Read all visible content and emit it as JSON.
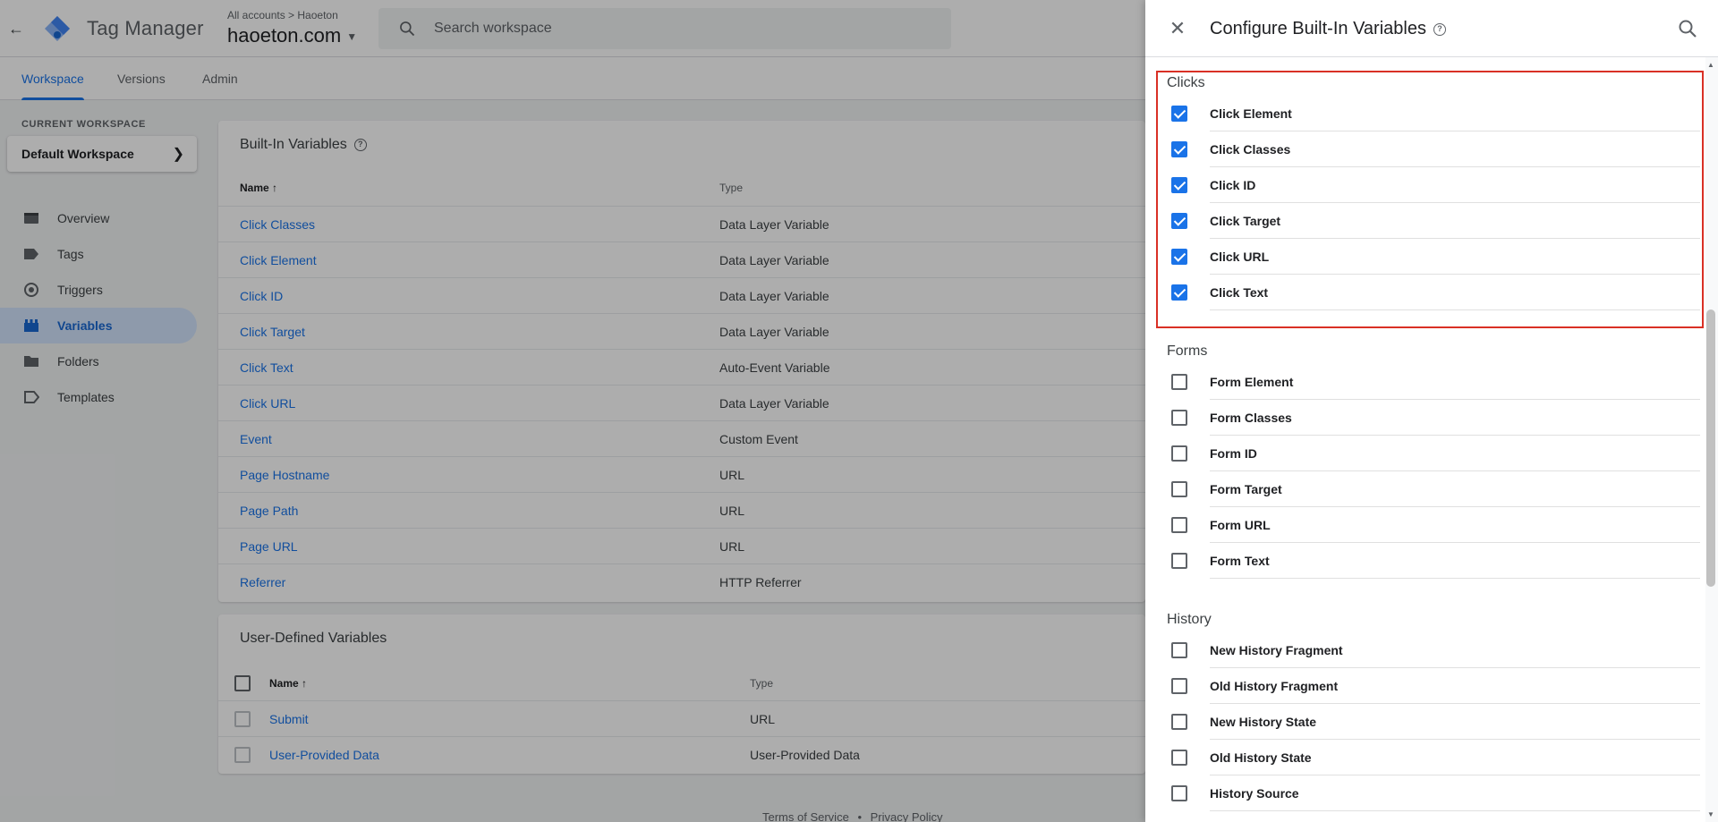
{
  "app": {
    "title": "Tag Manager",
    "breadcrumb_small": "All accounts > Haoeton",
    "container_name": "haoeton.com",
    "search_placeholder": "Search workspace"
  },
  "tabs": [
    "Workspace",
    "Versions",
    "Admin"
  ],
  "sidebar": {
    "workspace_label": "CURRENT WORKSPACE",
    "workspace_name": "Default Workspace",
    "items": [
      {
        "label": "Overview",
        "icon": "folder-icon"
      },
      {
        "label": "Tags",
        "icon": "tag-icon"
      },
      {
        "label": "Triggers",
        "icon": "trigger-icon"
      },
      {
        "label": "Variables",
        "icon": "variables-icon"
      },
      {
        "label": "Folders",
        "icon": "folder-icon"
      },
      {
        "label": "Templates",
        "icon": "template-icon"
      }
    ]
  },
  "builtin": {
    "title": "Built-In Variables",
    "col_name": "Name",
    "col_type": "Type",
    "rows": [
      {
        "name": "Click Classes",
        "type": "Data Layer Variable"
      },
      {
        "name": "Click Element",
        "type": "Data Layer Variable"
      },
      {
        "name": "Click ID",
        "type": "Data Layer Variable"
      },
      {
        "name": "Click Target",
        "type": "Data Layer Variable"
      },
      {
        "name": "Click Text",
        "type": "Auto-Event Variable"
      },
      {
        "name": "Click URL",
        "type": "Data Layer Variable"
      },
      {
        "name": "Event",
        "type": "Custom Event"
      },
      {
        "name": "Page Hostname",
        "type": "URL"
      },
      {
        "name": "Page Path",
        "type": "URL"
      },
      {
        "name": "Page URL",
        "type": "URL"
      },
      {
        "name": "Referrer",
        "type": "HTTP Referrer"
      }
    ]
  },
  "userdefined": {
    "title": "User-Defined Variables",
    "col_name": "Name",
    "col_type": "Type",
    "rows": [
      {
        "name": "Submit",
        "type": "URL"
      },
      {
        "name": "User-Provided Data",
        "type": "User-Provided Data"
      }
    ]
  },
  "footer": {
    "terms": "Terms of Service",
    "sep": "•",
    "privacy": "Privacy Policy"
  },
  "panel": {
    "title": "Configure Built-In Variables",
    "sections": [
      {
        "title": "Clicks",
        "items": [
          {
            "label": "Click Element",
            "checked": true
          },
          {
            "label": "Click Classes",
            "checked": true
          },
          {
            "label": "Click ID",
            "checked": true
          },
          {
            "label": "Click Target",
            "checked": true
          },
          {
            "label": "Click URL",
            "checked": true
          },
          {
            "label": "Click Text",
            "checked": true
          }
        ]
      },
      {
        "title": "Forms",
        "items": [
          {
            "label": "Form Element",
            "checked": false
          },
          {
            "label": "Form Classes",
            "checked": false
          },
          {
            "label": "Form ID",
            "checked": false
          },
          {
            "label": "Form Target",
            "checked": false
          },
          {
            "label": "Form URL",
            "checked": false
          },
          {
            "label": "Form Text",
            "checked": false
          }
        ]
      },
      {
        "title": "History",
        "items": [
          {
            "label": "New History Fragment",
            "checked": false
          },
          {
            "label": "Old History Fragment",
            "checked": false
          },
          {
            "label": "New History State",
            "checked": false
          },
          {
            "label": "Old History State",
            "checked": false
          },
          {
            "label": "History Source",
            "checked": false
          }
        ]
      }
    ]
  },
  "colors": {
    "accent": "#1a73e8",
    "highlight": "#d93025"
  }
}
